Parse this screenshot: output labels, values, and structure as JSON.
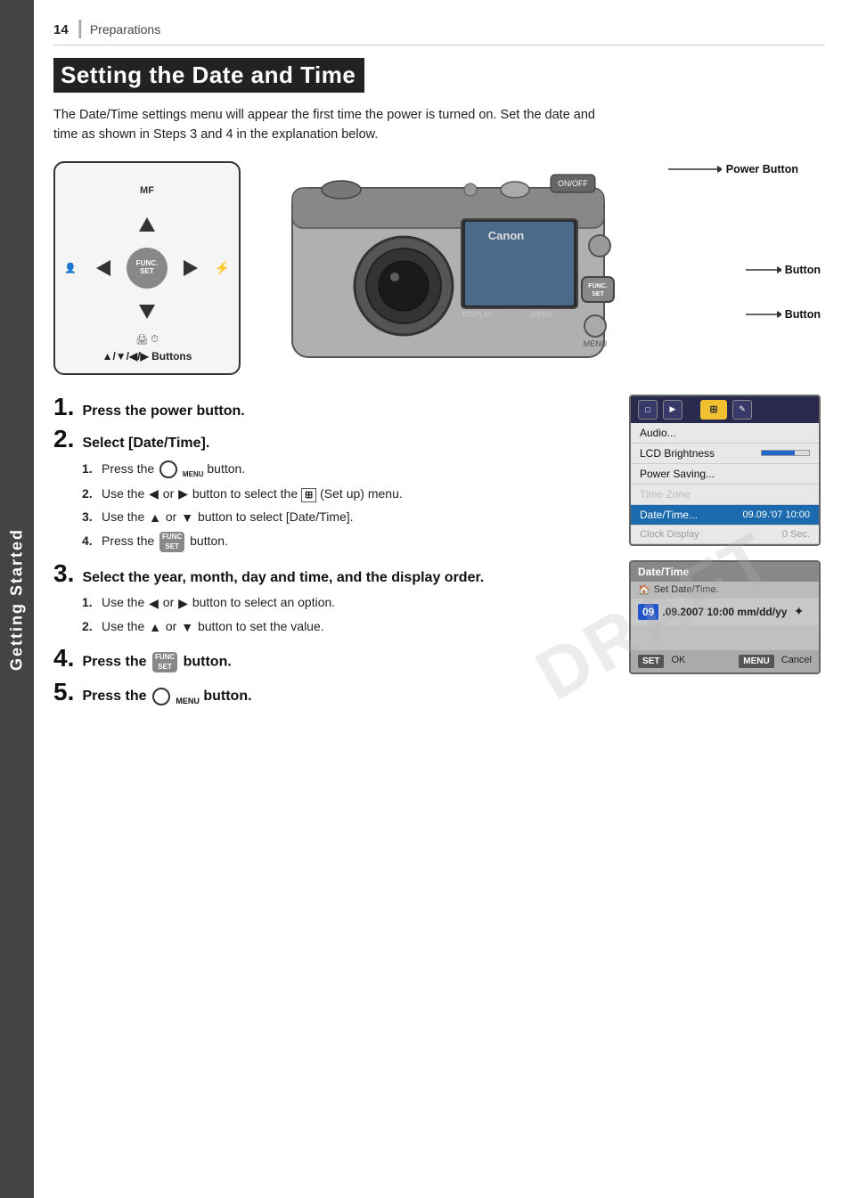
{
  "sidebar": {
    "label": "Getting Started"
  },
  "header": {
    "page_number": "14",
    "section": "Preparations"
  },
  "title": "Setting the Date and Time",
  "intro": "The Date/Time settings menu will appear the first time the power is turned on. Set the date and time as shown in Steps 3 and 4 in the explanation below.",
  "diagram": {
    "controls_label": "▲/▼/◀/▶ Buttons",
    "mf_label": "MF",
    "callout_power": "Power Button",
    "callout_func": "Button",
    "callout_menu": "Button"
  },
  "steps": [
    {
      "number": "1",
      "title": "Press the power button."
    },
    {
      "number": "2",
      "title": "Select [Date/Time].",
      "substeps": [
        {
          "num": "1.",
          "text": "Press the  MENU  button."
        },
        {
          "num": "2.",
          "text": "Use the ◀ or ▶ button to select the  ⊞  (Set up) menu."
        },
        {
          "num": "3.",
          "text": "Use the ▲ or ▼ button to select [Date/Time]."
        },
        {
          "num": "4.",
          "text": "Press the  FUNC/SET  button."
        }
      ]
    },
    {
      "number": "3",
      "title": "Select the year, month, day and time, and the display order.",
      "substeps": [
        {
          "num": "1.",
          "text": "Use the ◀ or ▶ button to select an option."
        },
        {
          "num": "2.",
          "text": "Use the ▲ or ▼ button to set the value."
        }
      ]
    },
    {
      "number": "4",
      "title": "Press the  FUNC/SET  button."
    },
    {
      "number": "5",
      "title": "Press the  MENU  button."
    }
  ],
  "menu_screen": {
    "items": [
      {
        "label": "Audio...",
        "value": "",
        "highlight": false
      },
      {
        "label": "LCD Brightness",
        "value": "bar",
        "highlight": false
      },
      {
        "label": "Power Saving...",
        "value": "",
        "highlight": false
      },
      {
        "label": "Time Zone",
        "value": "",
        "highlight": false
      },
      {
        "label": "Date/Time...",
        "value": "09.09.'07 10:00",
        "highlight": true
      },
      {
        "label": "Clock Display",
        "value": "0 Sec.",
        "highlight": false,
        "dim": true
      }
    ]
  },
  "datetime_screen": {
    "title": "Date/Time",
    "subtitle": "Set Date/Time.",
    "value": "09.09.2007 10:00  mm/dd/yy",
    "value_highlight": "09",
    "ok_label": "SET OK",
    "cancel_label": "MENU Cancel"
  },
  "draft_watermark": "DRAFT"
}
